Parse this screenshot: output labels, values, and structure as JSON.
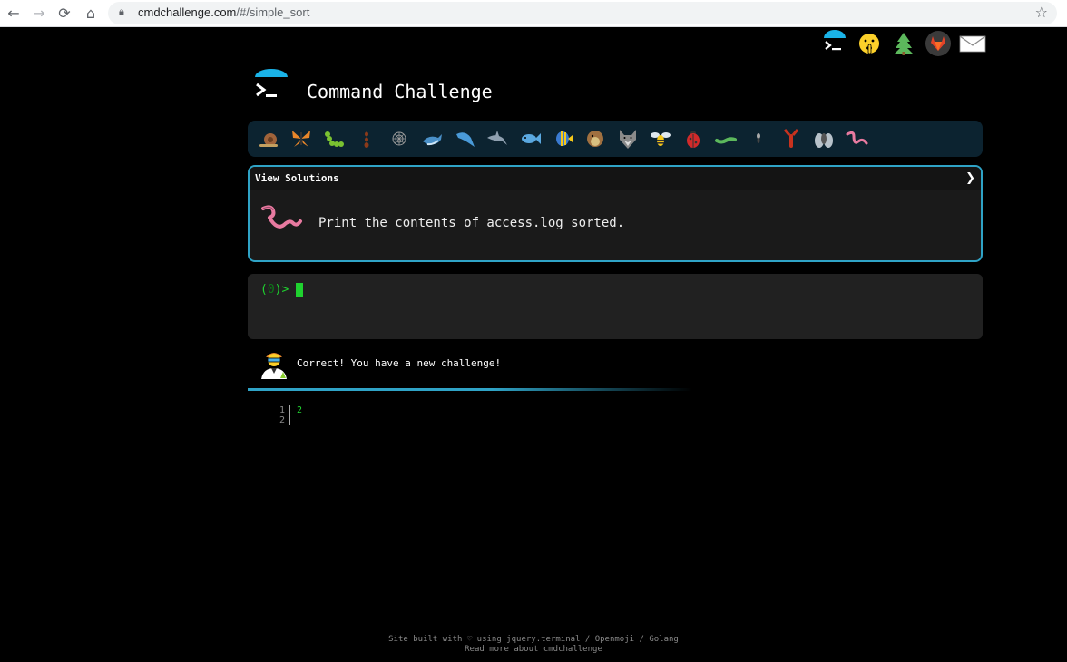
{
  "browser": {
    "url_domain": "cmdchallenge.com",
    "url_path": "/#/simple_sort",
    "icons": [
      "back-icon",
      "forward-icon",
      "reload-icon",
      "home-icon",
      "lock-icon",
      "bookmark-star-icon"
    ]
  },
  "top_icons": [
    "cmdchallenge-logo-icon",
    "shushing-face-icon",
    "evergreen-tree-icon",
    "gitlab-icon",
    "envelope-icon"
  ],
  "header": {
    "title": "Command Challenge"
  },
  "challenges": [
    "snail-icon",
    "butterfly-icon",
    "caterpillar-icon",
    "ant-icon",
    "spider-web-icon",
    "whale-icon",
    "dolphin-icon",
    "shark-icon",
    "fish-icon",
    "tropical-fish-icon",
    "blowfish-icon",
    "wolf-icon",
    "bee-icon",
    "ladybug-icon",
    "worm-icon",
    "mosquito-icon",
    "lobster-icon",
    "fly-icon",
    "earthworm-icon"
  ],
  "panel": {
    "view_solutions": "View Solutions",
    "chevron": "❯",
    "task": "Print the contents of access.log sorted."
  },
  "terminal": {
    "prompt_open": "(",
    "prompt_num": "0",
    "prompt_close": ")>"
  },
  "feedback": {
    "message": "Correct! You have a new challenge!",
    "progress": 0.6
  },
  "output": {
    "line_numbers": "1\n2",
    "text": "2"
  },
  "footer": {
    "line1": "Site built with ♡ using jquery.terminal / Openmoji / Golang",
    "line2": "Read more about cmdchallenge"
  },
  "colors": {
    "accent": "#2fa3c6",
    "terminal_green": "#1fd22f"
  }
}
